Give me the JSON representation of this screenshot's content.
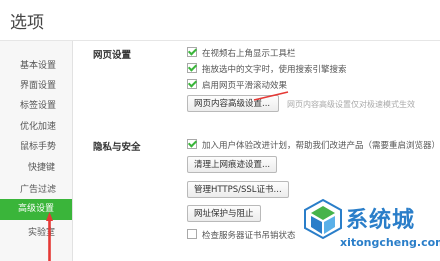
{
  "header": {
    "title": "选项"
  },
  "sidebar": {
    "items": [
      {
        "label": "基本设置"
      },
      {
        "label": "界面设置"
      },
      {
        "label": "标签设置"
      },
      {
        "label": "优化加速"
      },
      {
        "label": "鼠标手势"
      },
      {
        "label": "快捷键"
      },
      {
        "label": "广告过滤"
      },
      {
        "label": "高级设置",
        "active": true
      },
      {
        "label": "实验室"
      }
    ]
  },
  "web_settings": {
    "section_label": "网页设置",
    "options": [
      {
        "label": "在视频右上角显示工具栏",
        "checked": true
      },
      {
        "label": "拖放选中的文字时，使用搜索引擎搜索",
        "checked": true
      },
      {
        "label": "启用网页平滑滚动效果",
        "checked": true
      }
    ],
    "advanced_button": "网页内容高级设置...",
    "advanced_hint": "网页内容高级设置仅对极速模式生效"
  },
  "privacy": {
    "section_label": "隐私与安全",
    "join_option": {
      "label": "加入用户体验改进计划，帮助我们改进产品（需要重启浏览器）",
      "checked": true
    },
    "buttons": [
      {
        "label": "清理上网痕迹设置..."
      },
      {
        "label": "管理HTTPS/SSL证书..."
      },
      {
        "label": "网址保护与阻止"
      }
    ],
    "cert_check_option": {
      "label": "检查服务器证书吊销状态",
      "checked": false
    }
  },
  "watermark": {
    "brand_cn": "系统城",
    "brand_en": "xitongcheng.com",
    "colors": {
      "blue": "#2a7ec9",
      "green": "#46b34a"
    }
  },
  "annotation": {
    "color": "#e53935"
  },
  "theme": {
    "accent": "#3ab53a"
  }
}
